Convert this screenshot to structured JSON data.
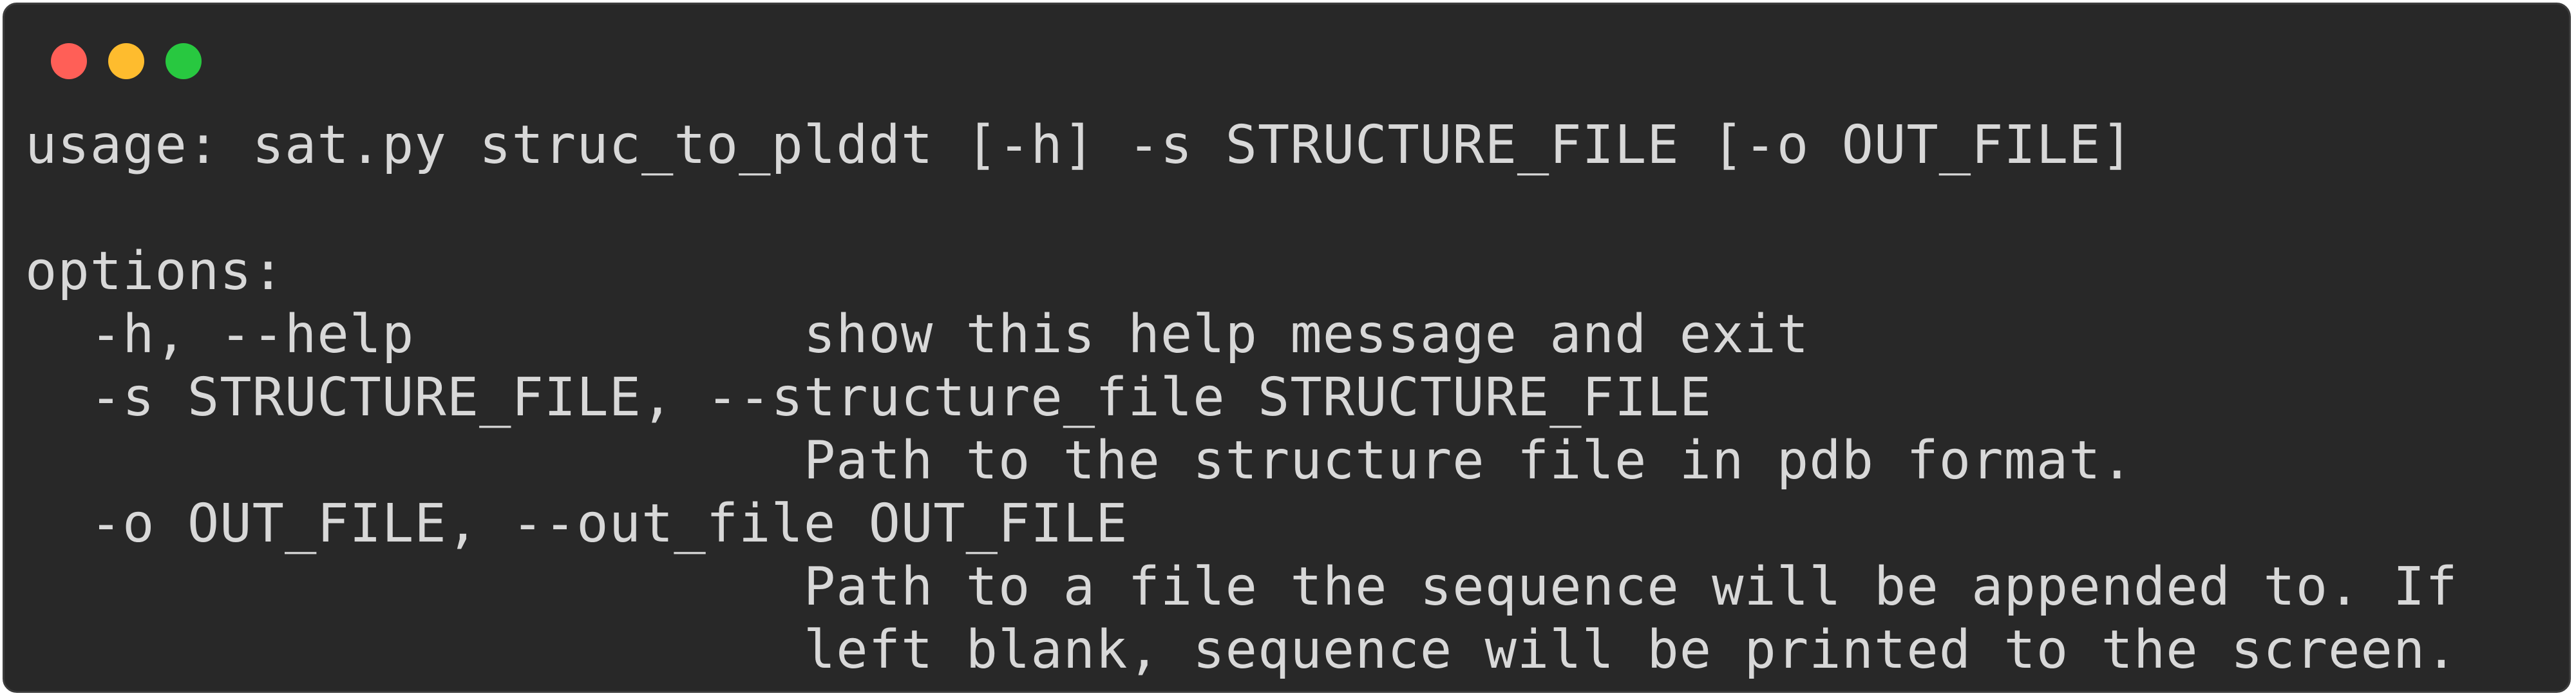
{
  "window": {
    "traffic_lights": [
      {
        "name": "close",
        "color": "#ff5f57"
      },
      {
        "name": "minimize",
        "color": "#febc2e"
      },
      {
        "name": "zoom",
        "color": "#28c840"
      }
    ]
  },
  "terminal": {
    "lines": [
      "usage: sat.py struc_to_plddt [-h] -s STRUCTURE_FILE [-o OUT_FILE]",
      "",
      "options:",
      "  -h, --help            show this help message and exit",
      "  -s STRUCTURE_FILE, --structure_file STRUCTURE_FILE",
      "                        Path to the structure file in pdb format.",
      "  -o OUT_FILE, --out_file OUT_FILE",
      "                        Path to a file the sequence will be appended to. If",
      "                        left blank, sequence will be printed to the screen."
    ]
  }
}
